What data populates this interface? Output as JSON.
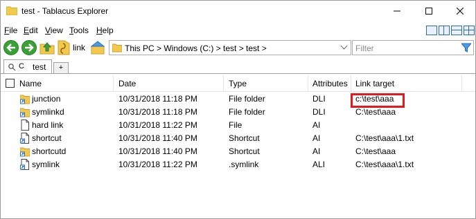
{
  "window": {
    "title": "test - Tablacus Explorer"
  },
  "menu": [
    "File",
    "Edit",
    "View",
    "Tools",
    "Help"
  ],
  "menu_accel": [
    "F",
    "E",
    "V",
    "T",
    "H"
  ],
  "toolbar": {
    "link_label": "link",
    "address": "This PC > Windows (C:) > test > test >",
    "filter_placeholder": "Filter"
  },
  "tabs": {
    "drive_label": "C",
    "active_tab": "test",
    "add_label": "+"
  },
  "columns": [
    "Name",
    "Date",
    "Type",
    "Attributes",
    "Link target"
  ],
  "rows": [
    {
      "name": "junction",
      "date": "10/31/2018 11:18 PM",
      "type": "File folder",
      "attributes": "DLI",
      "link_target": "c:\\test\\aaa",
      "icon": "folder-link-icon"
    },
    {
      "name": "symlinkd",
      "date": "10/31/2018 11:18 PM",
      "type": "File folder",
      "attributes": "DLI",
      "link_target": "C:\\test\\aaa",
      "icon": "folder-link-icon"
    },
    {
      "name": "hard link",
      "date": "10/31/2018 11:22 PM",
      "type": "File",
      "attributes": "AI",
      "link_target": "",
      "icon": "file-icon"
    },
    {
      "name": "shortcut",
      "date": "10/31/2018 11:40 PM",
      "type": "Shortcut",
      "attributes": "AI",
      "link_target": "C:\\test\\aaa\\1.txt",
      "icon": "shortcut-icon"
    },
    {
      "name": "shortcutd",
      "date": "10/31/2018 11:40 PM",
      "type": "Shortcut",
      "attributes": "AI",
      "link_target": "C:\\test\\aaa",
      "icon": "folder-shortcut-icon"
    },
    {
      "name": "symlink",
      "date": "10/31/2018 11:22 PM",
      "type": ".symlink",
      "attributes": "ALI",
      "link_target": "C:\\test\\aaa\\1.txt",
      "icon": "shortcut-icon"
    }
  ],
  "colors": {
    "highlight": "#e8171c",
    "folder": "#f2c94c",
    "nav_green": "#3aa037",
    "accent_blue": "#2a6bb8"
  }
}
